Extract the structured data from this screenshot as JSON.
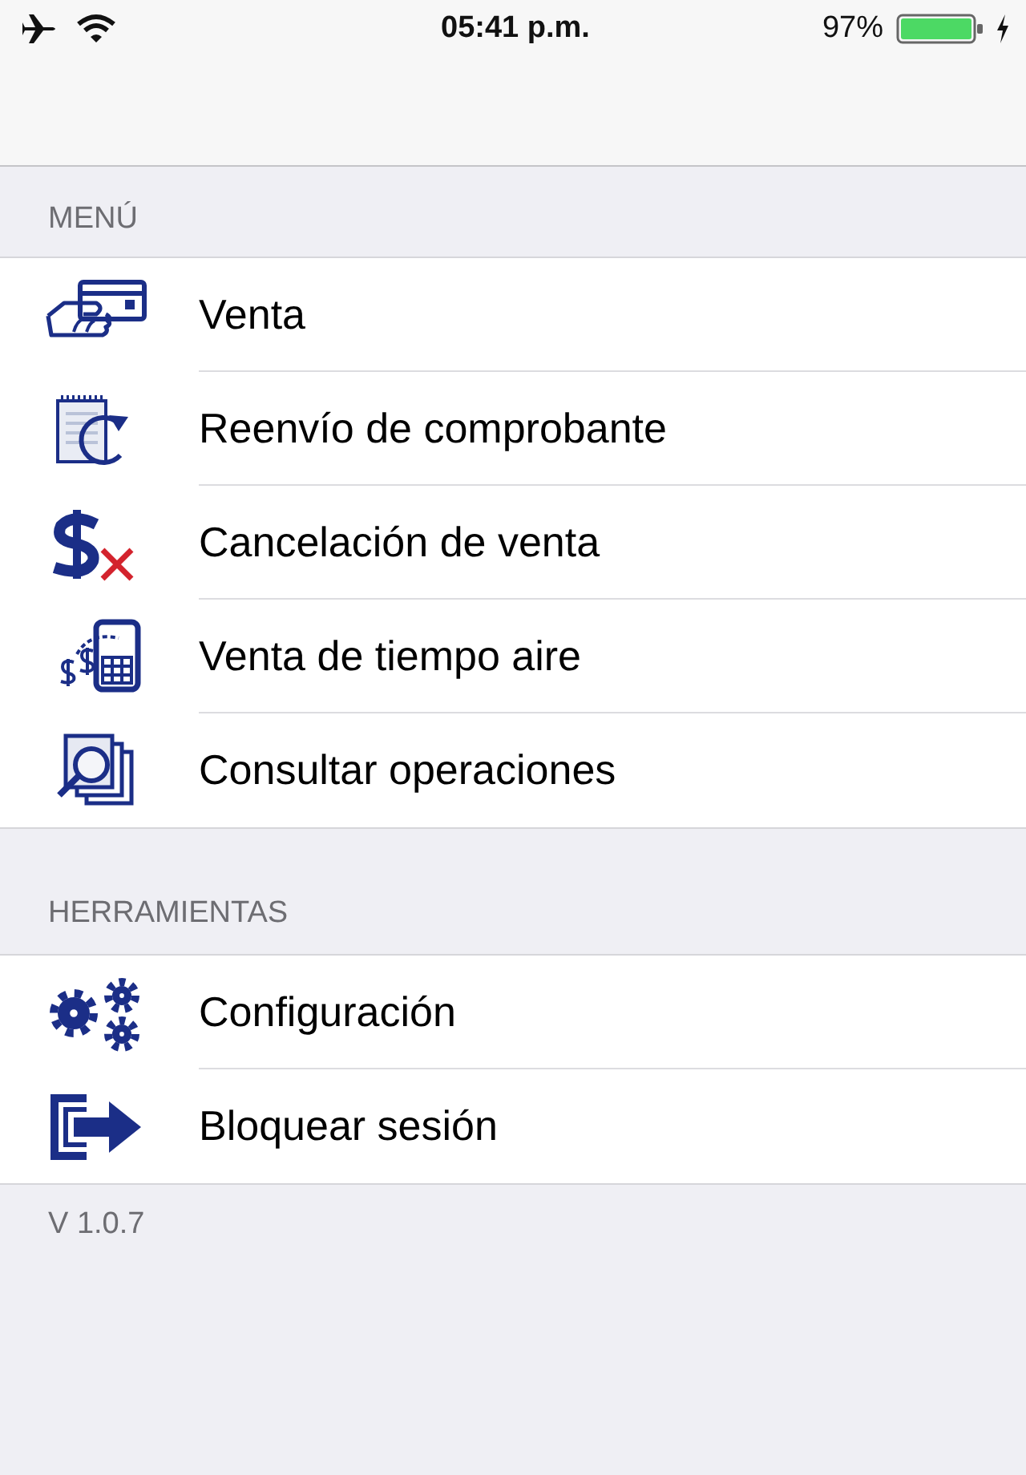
{
  "status_bar": {
    "time": "05:41 p.m.",
    "battery": "97%"
  },
  "sections": [
    {
      "header": "MENÚ",
      "items": [
        {
          "label": "Venta",
          "kind": "card"
        },
        {
          "label": "Reenvío de comprobante",
          "kind": "resend"
        },
        {
          "label": "Cancelación de venta",
          "kind": "cancel"
        },
        {
          "label": "Venta de tiempo aire",
          "kind": "airtime"
        },
        {
          "label": "Consultar operaciones",
          "kind": "query"
        }
      ]
    },
    {
      "header": "HERRAMIENTAS",
      "items": [
        {
          "label": "Configuración",
          "kind": "settings"
        },
        {
          "label": "Bloquear sesión",
          "kind": "exit"
        }
      ]
    }
  ],
  "version": "V 1.0.7"
}
